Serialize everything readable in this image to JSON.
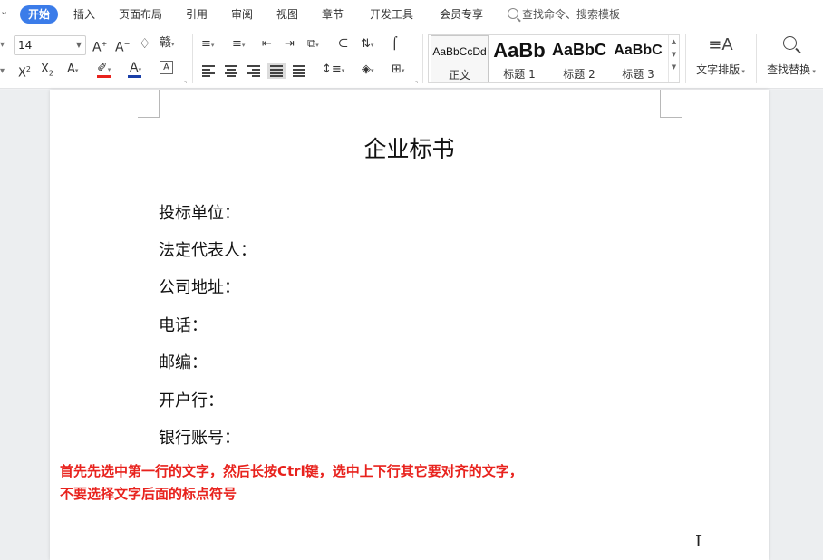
{
  "menu": {
    "tabs": [
      "开始",
      "插入",
      "页面布局",
      "引用",
      "审阅",
      "视图",
      "章节",
      "开发工具",
      "会员专享"
    ],
    "search_placeholder": "查找命令、搜索模板"
  },
  "toolbar": {
    "font_size": "14",
    "styles": [
      {
        "sample": "AaBbCcDd",
        "name": "正文"
      },
      {
        "sample": "AaBb",
        "name": "标题 1"
      },
      {
        "sample": "AaBbC",
        "name": "标题 2"
      },
      {
        "sample": "AaBbC",
        "name": "标题 3"
      }
    ],
    "text_layout_label": "文字排版",
    "find_replace_label": "查找替换"
  },
  "document": {
    "title": "企业标书",
    "fields": [
      "投标单位：",
      "法定代表人：",
      "公司地址：",
      "电话：",
      "邮编：",
      "开户行：",
      "银行账号："
    ]
  },
  "annotation": {
    "line1": "首先先选中第一行的文字，然后长按Ctrl键，选中上下行其它要对齐的文字，",
    "line2": "不要选择文字后面的标点符号"
  },
  "colors": {
    "accent": "#3b7ce9",
    "annotation": "#e8221d",
    "font_color_bar": "#1a3fa8",
    "highlight_bar": "#e8221d"
  }
}
